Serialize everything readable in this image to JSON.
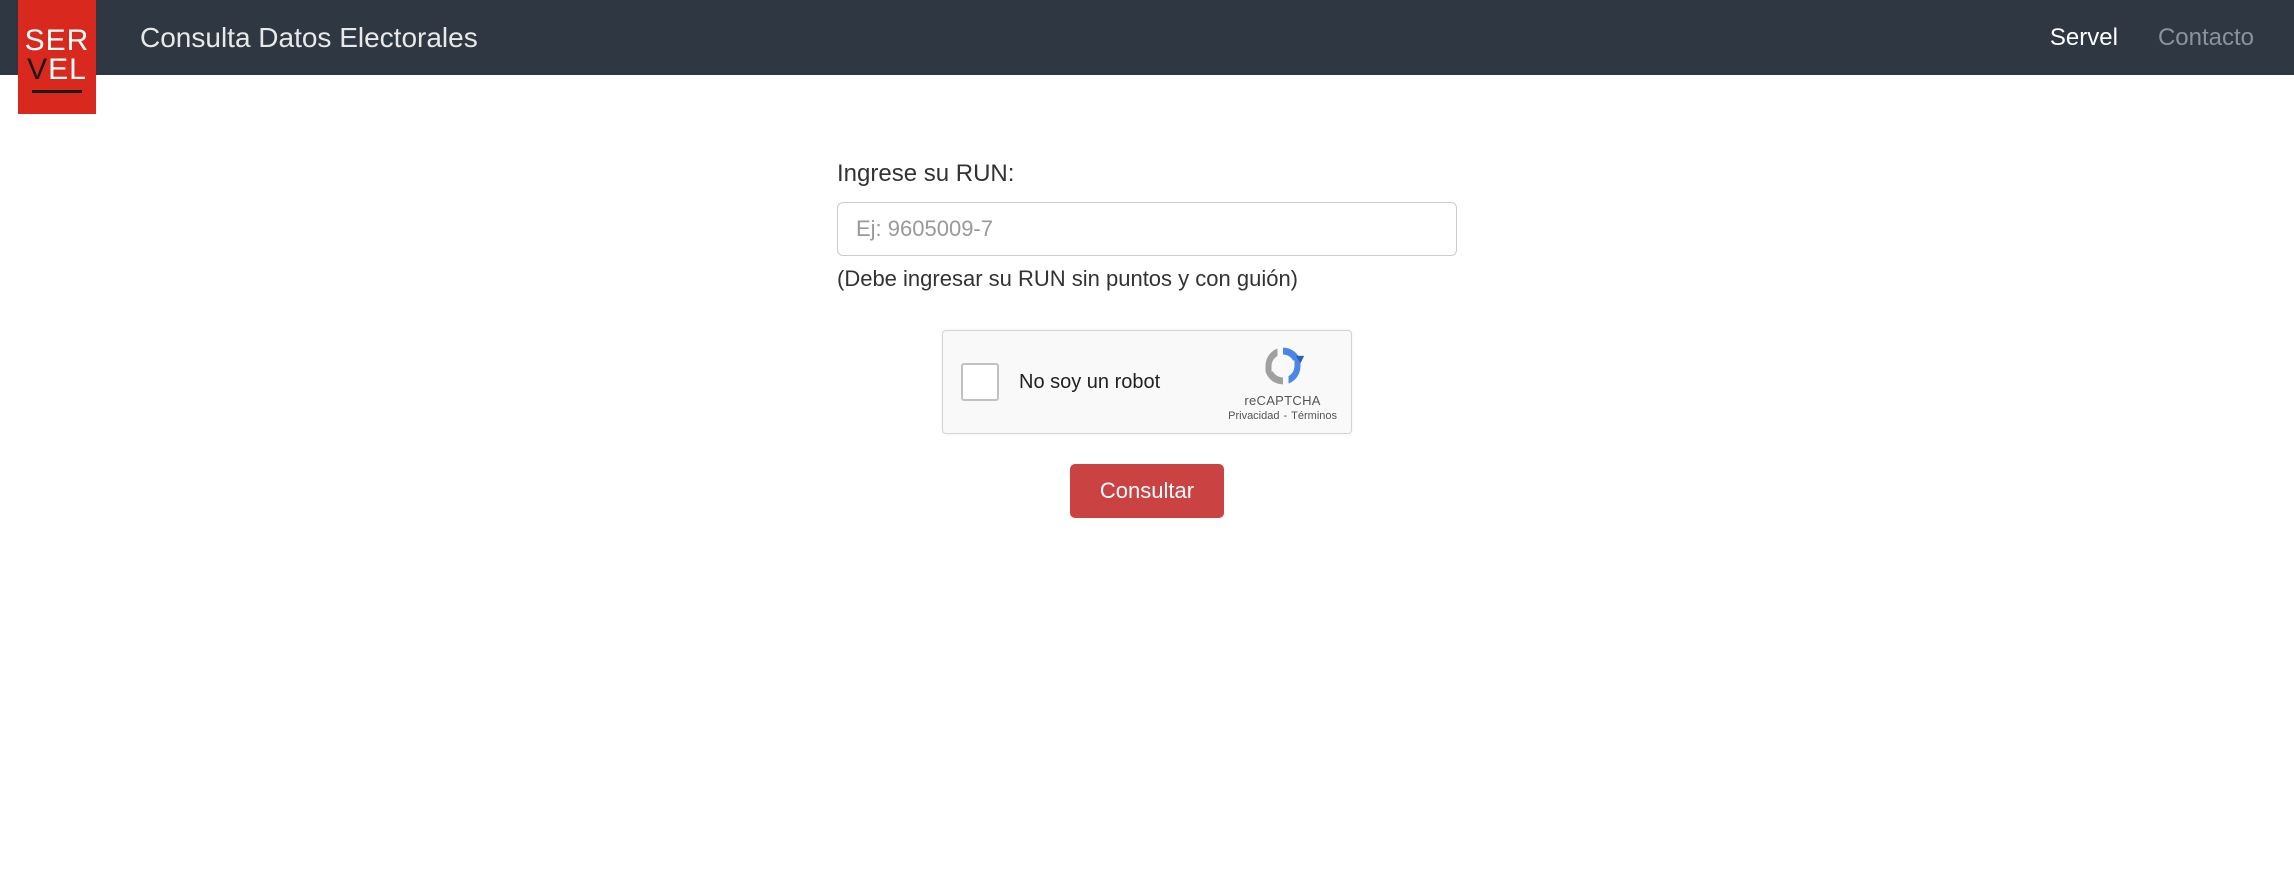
{
  "header": {
    "logo": {
      "line1": "SER",
      "line2_v": "V",
      "line2_el": "EL"
    },
    "title": "Consulta Datos Electorales",
    "nav": {
      "servel": "Servel",
      "contacto": "Contacto"
    }
  },
  "form": {
    "label": "Ingrese su RUN:",
    "placeholder": "Ej: 9605009-7",
    "value": "",
    "help_text": "(Debe ingresar su RUN sin puntos y con guión)",
    "submit_label": "Consultar"
  },
  "recaptcha": {
    "label": "No soy un robot",
    "brand": "reCAPTCHA",
    "privacy": "Privacidad",
    "separator": "-",
    "terms": "Términos"
  }
}
